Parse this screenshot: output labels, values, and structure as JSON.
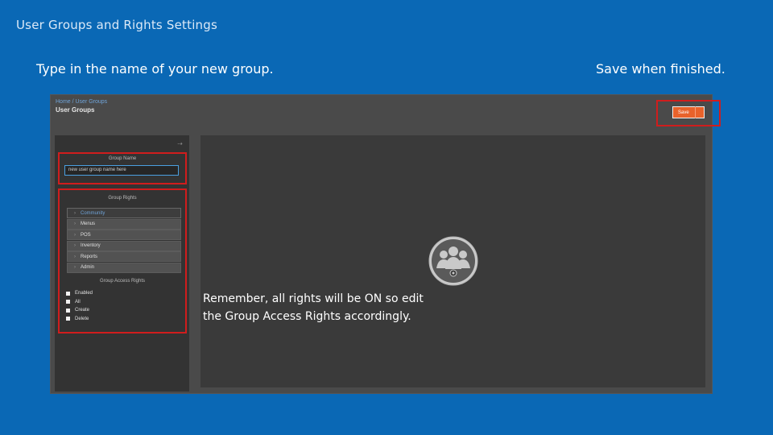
{
  "slide": {
    "title": "User Groups and Rights Settings",
    "caption_left": "Type in the name of your new group.",
    "caption_right": "Save when finished.",
    "reminder_line1": "Remember, all rights will be ON so edit",
    "reminder_line2": "the Group Access Rights accordingly."
  },
  "app": {
    "breadcrumb": "Home / User Groups",
    "page_title": "User Groups",
    "save_label": "Save",
    "sidebar": {
      "group_name_label": "Group Name",
      "group_name_value": "new user group name here",
      "group_rights_label": "Group Rights",
      "rights": [
        {
          "label": "Community",
          "active": true
        },
        {
          "label": "Menus"
        },
        {
          "label": "POS"
        },
        {
          "label": "Inventory"
        },
        {
          "label": "Reports"
        },
        {
          "label": "Admin"
        }
      ],
      "access_rights_label": "Group Access Rights",
      "access_rights": [
        "Enabled",
        "All",
        "Create",
        "Delete"
      ]
    }
  },
  "colors": {
    "slide_background": "#0a68b5",
    "highlight_red": "#d01d1d",
    "save_orange": "#e8622b"
  }
}
